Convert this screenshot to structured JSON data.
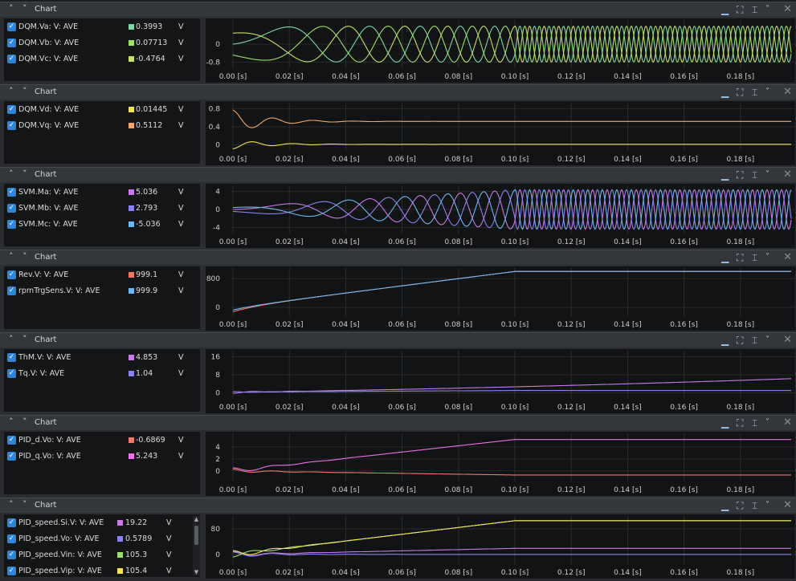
{
  "ui": {
    "x_unit": "[s]",
    "window_controls": [
      "minimize-icon",
      "fit-icon",
      "cursor-icon",
      "dropdown-icon",
      "close-icon"
    ]
  },
  "panels": [
    {
      "title": "Chart",
      "signals": [
        {
          "name": "DQM.Va: V: AVE",
          "value": "0.3993",
          "unit": "V",
          "color": "#7fd6a8"
        },
        {
          "name": "DQM.Vb: V: AVE",
          "value": "0.07713",
          "unit": "V",
          "color": "#9ee06a"
        },
        {
          "name": "DQM.Vc: V: AVE",
          "value": "-0.4764",
          "unit": "V",
          "color": "#c9e070"
        }
      ],
      "yticks": [
        "0",
        "-0.8"
      ],
      "chart_data": {
        "type": "line",
        "ylim": [
          -1,
          1
        ],
        "xlim": [
          0,
          0.198
        ],
        "x_ticks": [
          0,
          0.02,
          0.04,
          0.06,
          0.08,
          0.1,
          0.12,
          0.14,
          0.16,
          0.18
        ],
        "series": [
          {
            "name": "DQM.Va: V: AVE",
            "waveform": "sine",
            "amplitude": 0.8
          },
          {
            "name": "DQM.Vb: V: AVE",
            "waveform": "sine",
            "amplitude": 0.8
          },
          {
            "name": "DQM.Vc: V: AVE",
            "waveform": "sine",
            "amplitude": 0.8
          }
        ]
      }
    },
    {
      "title": "Chart",
      "signals": [
        {
          "name": "DQM.Vd: V: AVE",
          "value": "0.01445",
          "unit": "V",
          "color": "#f2e25a"
        },
        {
          "name": "DQM.Vq: V: AVE",
          "value": "0.5112",
          "unit": "V",
          "color": "#f0a868"
        }
      ],
      "yticks": [
        "0.8",
        "0.4",
        "0"
      ],
      "chart_data": {
        "type": "line",
        "ylim": [
          -0.1,
          0.9
        ],
        "xlim": [
          0,
          0.198
        ],
        "series": [
          {
            "name": "DQM.Vd: V: AVE",
            "steady": 0.01
          },
          {
            "name": "DQM.Vq: V: AVE",
            "steady": 0.52
          }
        ]
      }
    },
    {
      "title": "Chart",
      "signals": [
        {
          "name": "SVM.Ma: V: AVE",
          "value": "5.036",
          "unit": "V",
          "color": "#c77ae8"
        },
        {
          "name": "SVM.Mb: V: AVE",
          "value": "2.793",
          "unit": "V",
          "color": "#8a82ee"
        },
        {
          "name": "SVM.Mc: V: AVE",
          "value": "-5.036",
          "unit": "V",
          "color": "#6fb8f0"
        }
      ],
      "yticks": [
        "4",
        "0",
        "-4"
      ],
      "chart_data": {
        "type": "line",
        "ylim": [
          -5,
          5
        ],
        "xlim": [
          0,
          0.198
        ],
        "series": [
          {
            "name": "SVM.Ma: V: AVE",
            "waveform": "sine",
            "amplitude": 4.4
          },
          {
            "name": "SVM.Mb: V: AVE",
            "waveform": "sine",
            "amplitude": 4.4
          },
          {
            "name": "SVM.Mc: V: AVE",
            "waveform": "sine",
            "amplitude": 4.4
          }
        ]
      }
    },
    {
      "title": "Chart",
      "signals": [
        {
          "name": "Rev.V: V: AVE",
          "value": "999.1",
          "unit": "V",
          "color": "#f07868"
        },
        {
          "name": "rpmTrgSens.V: V: AVE",
          "value": "999.9",
          "unit": "V",
          "color": "#6fb8f0"
        }
      ],
      "yticks": [
        "800",
        "0"
      ],
      "chart_data": {
        "type": "line",
        "ylim": [
          -200,
          1050
        ],
        "xlim": [
          0,
          0.198
        ],
        "series": [
          {
            "name": "Rev.V: V: AVE",
            "ramp_to": 999.1,
            "ramp_end": 0.1
          },
          {
            "name": "rpmTrgSens.V: V: AVE",
            "ramp_to": 999.9,
            "ramp_end": 0.1
          }
        ]
      }
    },
    {
      "title": "Chart",
      "signals": [
        {
          "name": "ThM.V: V: AVE",
          "value": "4.853",
          "unit": "V",
          "color": "#c77ae8"
        },
        {
          "name": "Tq.V: V: AVE",
          "value": "1.04",
          "unit": "V",
          "color": "#8a82ee"
        }
      ],
      "yticks": [
        "16",
        "8",
        "0"
      ],
      "chart_data": {
        "type": "line",
        "ylim": [
          -2,
          18
        ],
        "xlim": [
          0,
          0.198
        ],
        "series": [
          {
            "name": "ThM.V: V: AVE"
          },
          {
            "name": "Tq.V: V: AVE"
          }
        ]
      }
    },
    {
      "title": "Chart",
      "signals": [
        {
          "name": "PID_d.Vo: V: AVE",
          "value": "-0.6869",
          "unit": "V",
          "color": "#f07868"
        },
        {
          "name": "PID_q.Vo: V: AVE",
          "value": "5.243",
          "unit": "V",
          "color": "#f070e8"
        }
      ],
      "yticks": [
        "4",
        "2",
        "0"
      ],
      "chart_data": {
        "type": "line",
        "ylim": [
          -1.5,
          6
        ],
        "xlim": [
          0,
          0.198
        ],
        "series": [
          {
            "name": "PID_d.Vo: V: AVE",
            "final": -0.6869
          },
          {
            "name": "PID_q.Vo: V: AVE",
            "ramp_to": 5.243,
            "ramp_end": 0.1
          }
        ]
      }
    },
    {
      "title": "Chart",
      "scroll": true,
      "signals": [
        {
          "name": "PID_speed.Si.V: V: AVE",
          "value": "19.22",
          "unit": "V",
          "color": "#c77ae8"
        },
        {
          "name": "PID_speed.Vo: V: AVE",
          "value": "0.5789",
          "unit": "V",
          "color": "#8a82ee"
        },
        {
          "name": "PID_speed.Vin: V: AVE",
          "value": "105.3",
          "unit": "V",
          "color": "#9ee06a"
        },
        {
          "name": "PID_speed.Vip: V: AVE",
          "value": "105.4",
          "unit": "V",
          "color": "#f2e25a"
        }
      ],
      "yticks": [
        "80",
        "0"
      ],
      "chart_data": {
        "type": "line",
        "ylim": [
          -25,
          115
        ],
        "xlim": [
          0,
          0.198
        ],
        "series": [
          {
            "name": "PID_speed.Si.V: V: AVE"
          },
          {
            "name": "PID_speed.Vo: V: AVE"
          },
          {
            "name": "PID_speed.Vin: V: AVE",
            "ramp_to": 105.3,
            "ramp_end": 0.1
          },
          {
            "name": "PID_speed.Vip: V: AVE",
            "ramp_to": 105.4,
            "ramp_end": 0.1
          }
        ]
      }
    }
  ]
}
